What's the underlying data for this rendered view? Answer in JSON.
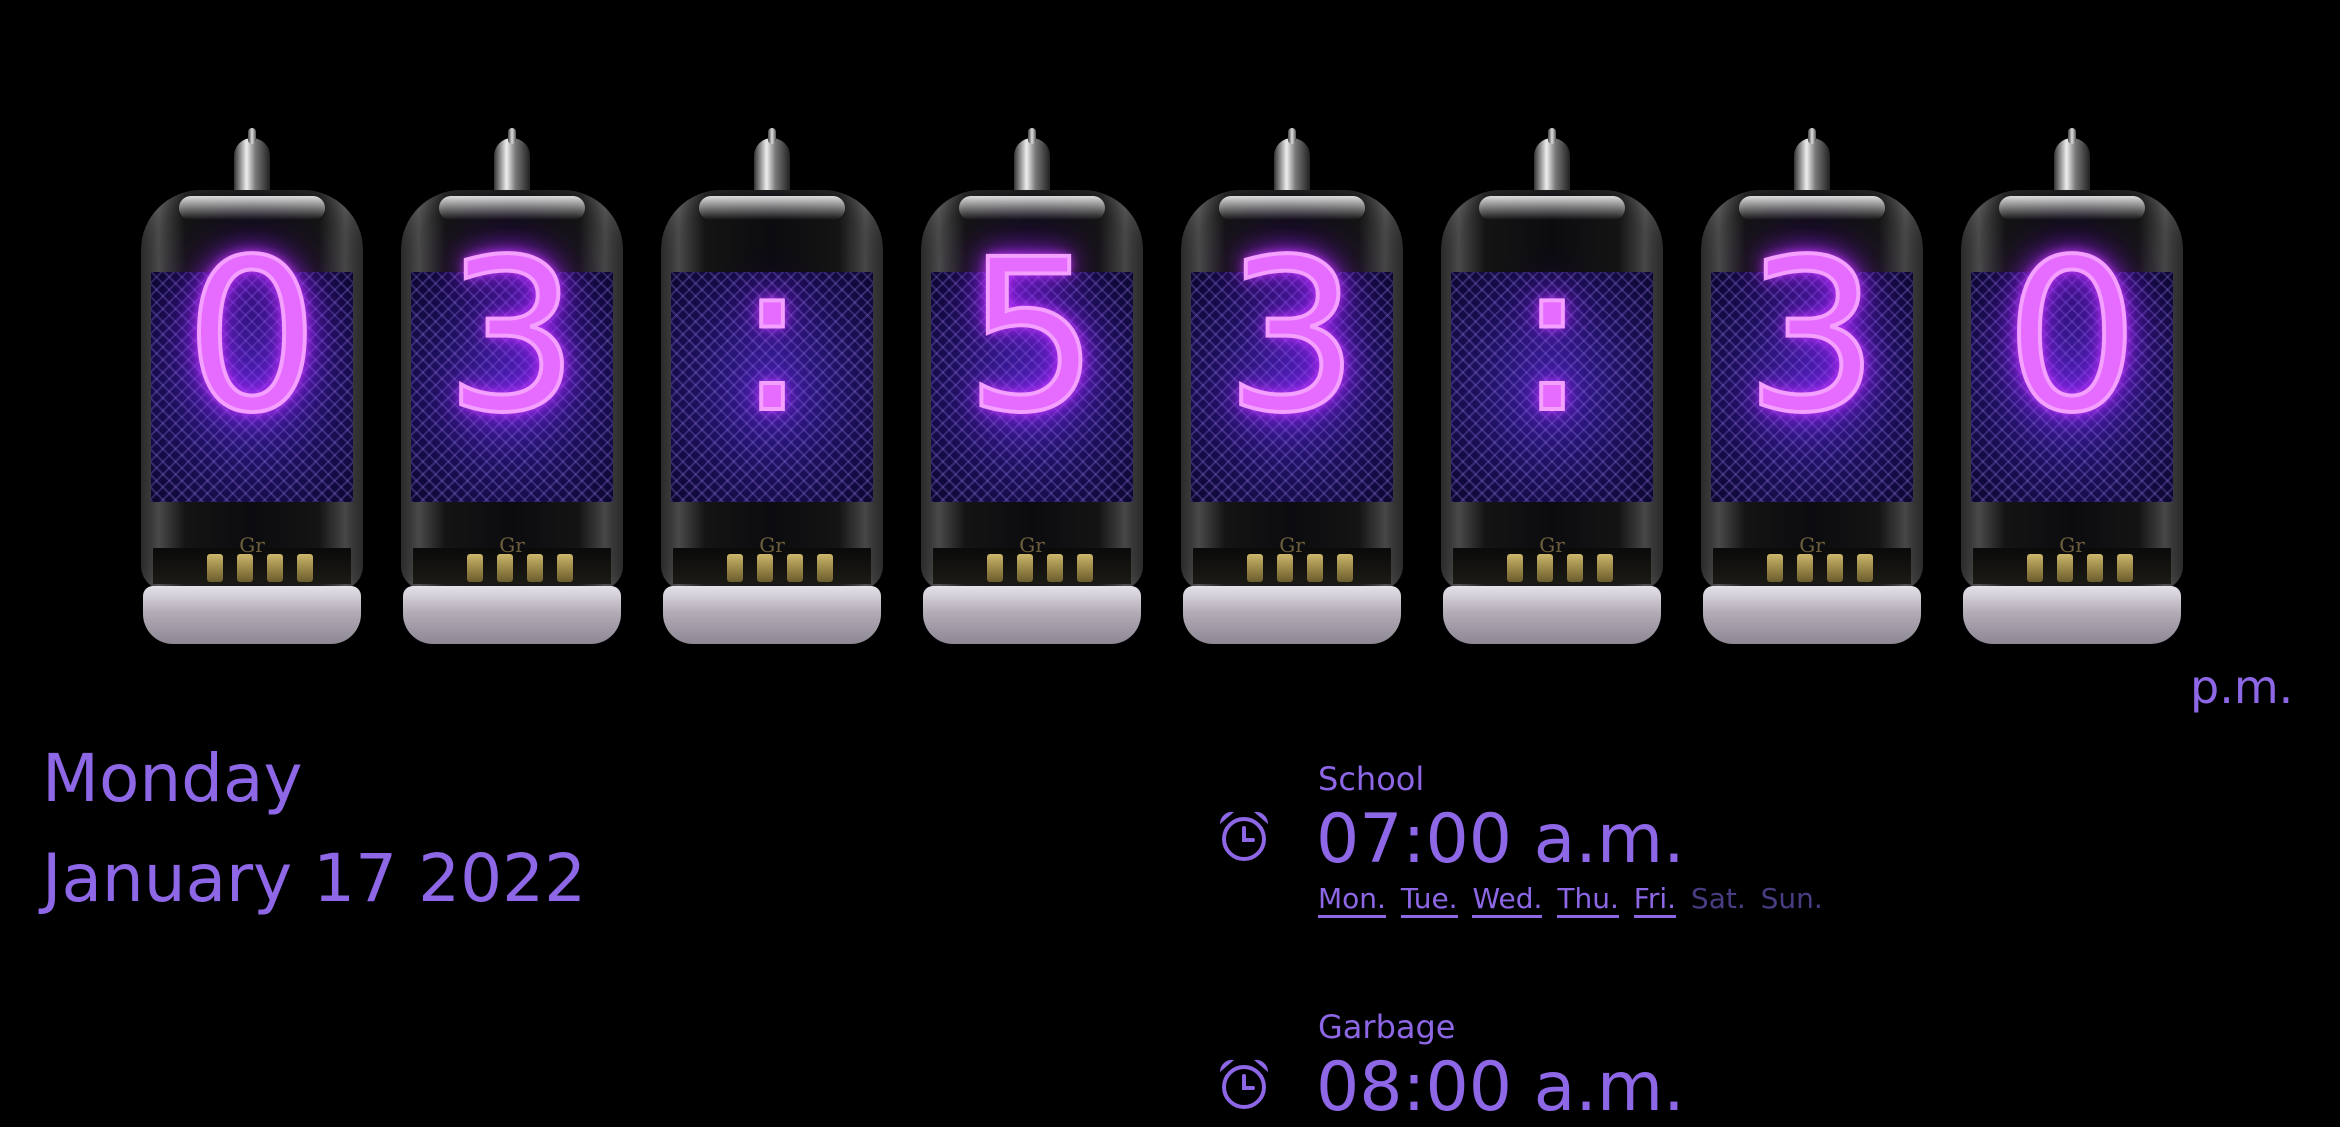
{
  "clock": {
    "digits": [
      "0",
      "3",
      ":",
      "5",
      "3",
      ":",
      "3",
      "0"
    ],
    "tube_base_label": "Gr",
    "ampm": "p.m."
  },
  "date": {
    "day": "Monday",
    "full": "January 17 2022"
  },
  "alarms": [
    {
      "label": "School",
      "time": "07:00 a.m.",
      "icon": "alarm-clock-icon",
      "days": [
        {
          "label": "Mon.",
          "active": true
        },
        {
          "label": "Tue.",
          "active": true
        },
        {
          "label": "Wed.",
          "active": true
        },
        {
          "label": "Thu.",
          "active": true
        },
        {
          "label": "Fri.",
          "active": true
        },
        {
          "label": "Sat.",
          "active": false
        },
        {
          "label": "Sun.",
          "active": false
        }
      ]
    },
    {
      "label": "Garbage",
      "time": "08:00 a.m.",
      "icon": "alarm-clock-icon"
    }
  ],
  "colors": {
    "text": "#8d67e6",
    "inactive_day": "#4a3c82",
    "nixie_glow": "#e66bff",
    "background": "#000000"
  }
}
